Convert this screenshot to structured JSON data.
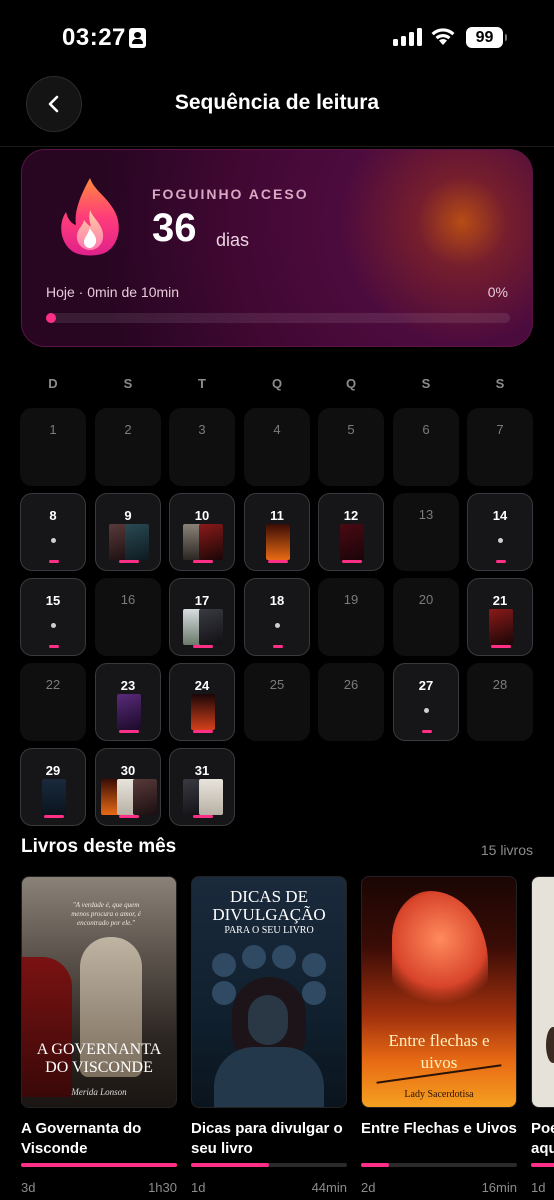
{
  "status_bar": {
    "time": "03:27",
    "battery": "99"
  },
  "header": {
    "title": "Sequência de leitura"
  },
  "streak": {
    "label": "FOGUINHO ACESO",
    "days": "36",
    "unit": "dias",
    "today_text": "Hoje · 0min de 10min",
    "today_percent": "0%",
    "progress_fraction": 0.0
  },
  "calendar": {
    "weekdays": [
      "D",
      "S",
      "T",
      "Q",
      "Q",
      "S",
      "S"
    ],
    "days": [
      {
        "n": "1"
      },
      {
        "n": "2"
      },
      {
        "n": "3"
      },
      {
        "n": "4"
      },
      {
        "n": "5"
      },
      {
        "n": "6"
      },
      {
        "n": "7"
      },
      {
        "n": "8",
        "active": true,
        "mark": "dot"
      },
      {
        "n": "9",
        "active": true,
        "mark": "covers",
        "covers": [
          "dark-romance",
          "teal-dark"
        ]
      },
      {
        "n": "10",
        "active": true,
        "mark": "covers",
        "covers": [
          "governanta",
          "red-dark"
        ]
      },
      {
        "n": "11",
        "active": true,
        "mark": "covers",
        "covers": [
          "flechas"
        ]
      },
      {
        "n": "12",
        "active": true,
        "mark": "covers",
        "covers": [
          "alfa"
        ]
      },
      {
        "n": "13"
      },
      {
        "n": "14",
        "active": true,
        "mark": "dot"
      },
      {
        "n": "15",
        "active": true,
        "mark": "dot"
      },
      {
        "n": "16"
      },
      {
        "n": "17",
        "active": true,
        "mark": "covers",
        "covers": [
          "light-landscape",
          "dark-scene"
        ]
      },
      {
        "n": "18",
        "active": true,
        "mark": "dot"
      },
      {
        "n": "19"
      },
      {
        "n": "20"
      },
      {
        "n": "21",
        "active": true,
        "mark": "covers",
        "covers": [
          "red-dark"
        ]
      },
      {
        "n": "22"
      },
      {
        "n": "23",
        "active": true,
        "mark": "covers",
        "covers": [
          "purple"
        ]
      },
      {
        "n": "24",
        "active": true,
        "mark": "covers",
        "covers": [
          "rotacao"
        ]
      },
      {
        "n": "25"
      },
      {
        "n": "26"
      },
      {
        "n": "27",
        "active": true,
        "mark": "dot"
      },
      {
        "n": "28"
      },
      {
        "n": "29",
        "active": true,
        "mark": "covers",
        "covers": [
          "dicas"
        ]
      },
      {
        "n": "30",
        "active": true,
        "mark": "covers",
        "covers": [
          "flechas",
          "light-cover",
          "dark-romance"
        ]
      },
      {
        "n": "31",
        "active": true,
        "mark": "covers",
        "covers": [
          "dark-scene",
          "light-cover"
        ]
      }
    ]
  },
  "books_section": {
    "title": "Livros deste mês",
    "count": "15 livros",
    "books": [
      {
        "title": "A Governanta do Visconde",
        "cover_quote": "\"A verdade é, que quem menos procura o amor, é encontrado por ele.\"",
        "cover_title_1": "A GOVERNANTA",
        "cover_title_2": "DO VISCONDE",
        "cover_author": "Merida Lonson",
        "progress": 1.0,
        "days": "3d",
        "time": "1h30"
      },
      {
        "title": "Dicas para divulgar o seu livro",
        "cover_title_1": "DICAS DE",
        "cover_title_2": "DIVULGAÇÃO",
        "cover_title_3": "PARA O SEU LIVRO",
        "progress": 0.5,
        "days": "1d",
        "time": "44min"
      },
      {
        "title": "Entre Flechas e Uivos",
        "cover_title_1": "Entre flechas e",
        "cover_title_2": "uivos",
        "cover_author": "Lady Sacerdotisa",
        "progress": 0.18,
        "days": "2d",
        "time": "16min"
      },
      {
        "title": "Poe aqu",
        "progress": 0.6,
        "days": "1d",
        "time": ""
      }
    ]
  }
}
